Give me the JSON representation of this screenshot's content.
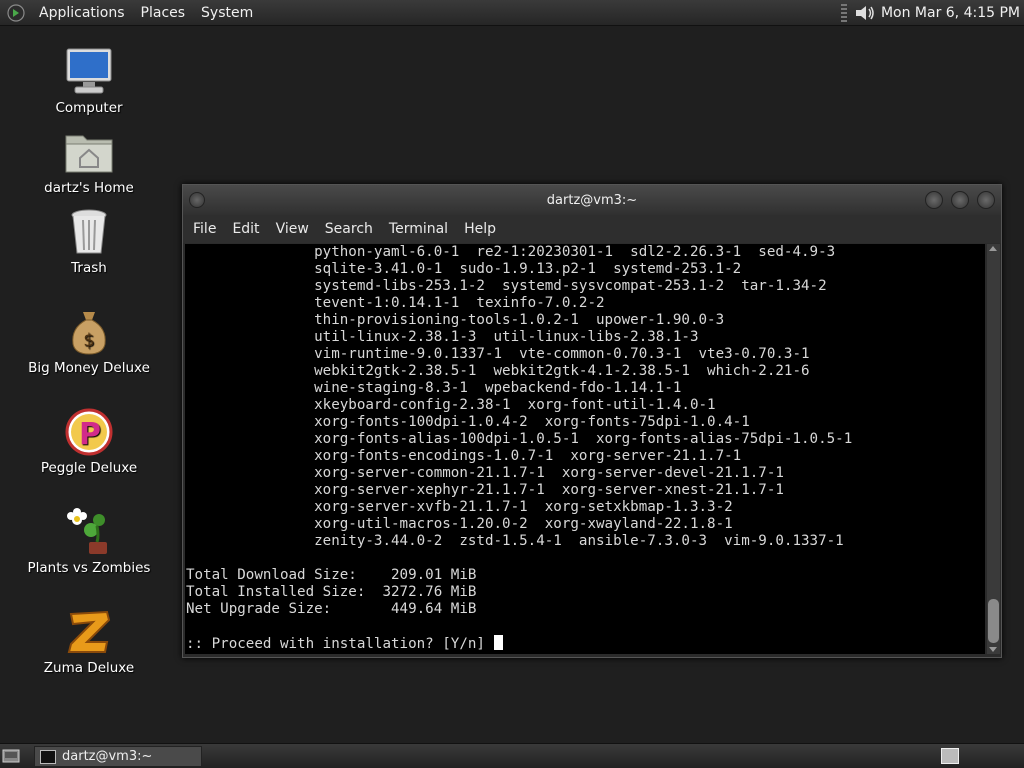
{
  "top_panel": {
    "menus": [
      "Applications",
      "Places",
      "System"
    ],
    "clock": "Mon Mar  6,  4:15 PM"
  },
  "desktop_icons": [
    {
      "label": "Computer",
      "icon": "computer-icon"
    },
    {
      "label": "dartz's Home",
      "icon": "home-folder-icon"
    },
    {
      "label": "Trash",
      "icon": "trash-icon"
    },
    {
      "label": "Big Money Deluxe",
      "icon": "money-bag-icon"
    },
    {
      "label": "Peggle Deluxe",
      "icon": "peggle-icon"
    },
    {
      "label": "Plants vs Zombies",
      "icon": "plants-icon"
    },
    {
      "label": "Zuma Deluxe",
      "icon": "zuma-icon"
    }
  ],
  "terminal": {
    "title": "dartz@vm3:~",
    "menus": [
      "File",
      "Edit",
      "View",
      "Search",
      "Terminal",
      "Help"
    ],
    "lines": [
      "               python-yaml-6.0-1  re2-1:20230301-1  sdl2-2.26.3-1  sed-4.9-3",
      "               sqlite-3.41.0-1  sudo-1.9.13.p2-1  systemd-253.1-2",
      "               systemd-libs-253.1-2  systemd-sysvcompat-253.1-2  tar-1.34-2",
      "               tevent-1:0.14.1-1  texinfo-7.0.2-2",
      "               thin-provisioning-tools-1.0.2-1  upower-1.90.0-3",
      "               util-linux-2.38.1-3  util-linux-libs-2.38.1-3",
      "               vim-runtime-9.0.1337-1  vte-common-0.70.3-1  vte3-0.70.3-1",
      "               webkit2gtk-2.38.5-1  webkit2gtk-4.1-2.38.5-1  which-2.21-6",
      "               wine-staging-8.3-1  wpebackend-fdo-1.14.1-1",
      "               xkeyboard-config-2.38-1  xorg-font-util-1.4.0-1",
      "               xorg-fonts-100dpi-1.0.4-2  xorg-fonts-75dpi-1.0.4-1",
      "               xorg-fonts-alias-100dpi-1.0.5-1  xorg-fonts-alias-75dpi-1.0.5-1",
      "               xorg-fonts-encodings-1.0.7-1  xorg-server-21.1.7-1",
      "               xorg-server-common-21.1.7-1  xorg-server-devel-21.1.7-1",
      "               xorg-server-xephyr-21.1.7-1  xorg-server-xnest-21.1.7-1",
      "               xorg-server-xvfb-21.1.7-1  xorg-setxkbmap-1.3.3-2",
      "               xorg-util-macros-1.20.0-2  xorg-xwayland-22.1.8-1",
      "               zenity-3.44.0-2  zstd-1.5.4-1  ansible-7.3.0-3  vim-9.0.1337-1",
      "",
      "Total Download Size:    209.01 MiB",
      "Total Installed Size:  3272.76 MiB",
      "Net Upgrade Size:       449.64 MiB",
      ""
    ],
    "prompt": ":: Proceed with installation? [Y/n] "
  },
  "taskbar": {
    "task_label": "dartz@vm3:~"
  }
}
